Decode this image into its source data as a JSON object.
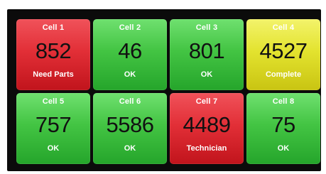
{
  "cells": [
    {
      "name": "Cell 1",
      "value": "852",
      "status": "Need Parts",
      "color": "#e02d34"
    },
    {
      "name": "Cell 2",
      "value": "46",
      "status": "OK",
      "color": "#3fc13f"
    },
    {
      "name": "Cell 3",
      "value": "801",
      "status": "OK",
      "color": "#3fc13f"
    },
    {
      "name": "Cell 4",
      "value": "4527",
      "status": "Complete",
      "color": "#e0df2c"
    },
    {
      "name": "Cell 5",
      "value": "757",
      "status": "OK",
      "color": "#3fc13f"
    },
    {
      "name": "Cell 6",
      "value": "5586",
      "status": "OK",
      "color": "#3fc13f"
    },
    {
      "name": "Cell 7",
      "value": "4489",
      "status": "Technician",
      "color": "#e02d34"
    },
    {
      "name": "Cell 8",
      "value": "75",
      "status": "OK",
      "color": "#3fc13f"
    }
  ]
}
